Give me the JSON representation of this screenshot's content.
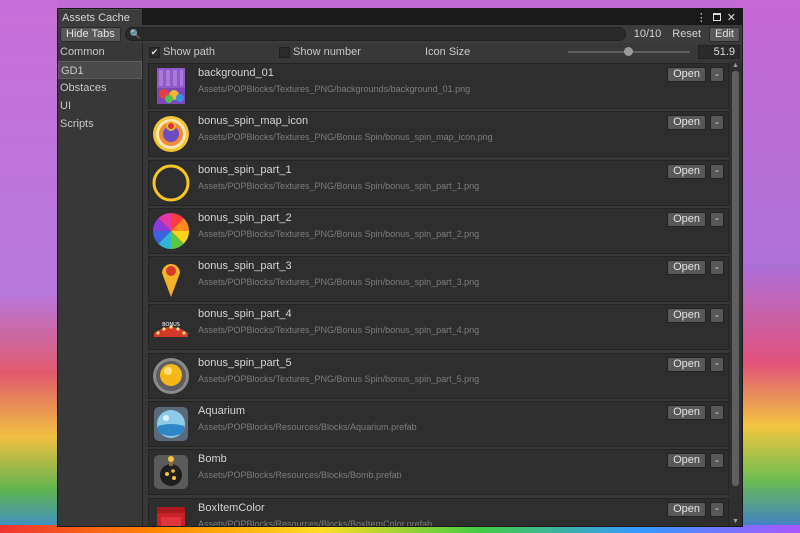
{
  "window": {
    "tab_title": "Assets Cache",
    "controls": {
      "menu": "⋮",
      "close": "✕"
    }
  },
  "toolbar": {
    "hide_tabs_label": "Hide Tabs",
    "search_icon": "🔍",
    "search_value": "",
    "count": "10/10",
    "reset_label": "Reset",
    "edit_label": "Edit"
  },
  "sidebar": {
    "items": [
      {
        "label": "Common",
        "active": false
      },
      {
        "label": "GD1",
        "active": true
      },
      {
        "label": "Obstaces",
        "active": false
      },
      {
        "label": "UI",
        "active": false
      },
      {
        "label": "Scripts",
        "active": false
      }
    ]
  },
  "options": {
    "show_path_label": "Show path",
    "show_path_checked": true,
    "show_number_label": "Show number",
    "show_number_checked": false,
    "icon_size_label": "Icon Size",
    "icon_size_value": "51.9",
    "icon_size_fraction": 0.49
  },
  "items": [
    {
      "name": "background_01",
      "path": "Assets/POPBlocks/Textures_PNG/backgrounds/background_01.png",
      "icon": "background-icon",
      "open_label": "Open",
      "remove_label": "-"
    },
    {
      "name": "bonus_spin_map_icon",
      "path": "Assets/POPBlocks/Textures_PNG/Bonus Spin/bonus_spin_map_icon.png",
      "icon": "spin-map-icon",
      "open_label": "Open",
      "remove_label": "-"
    },
    {
      "name": "bonus_spin_part_1",
      "path": "Assets/POPBlocks/Textures_PNG/Bonus Spin/bonus_spin_part_1.png",
      "icon": "ring-icon",
      "open_label": "Open",
      "remove_label": "-"
    },
    {
      "name": "bonus_spin_part_2",
      "path": "Assets/POPBlocks/Textures_PNG/Bonus Spin/bonus_spin_part_2.png",
      "icon": "color-wheel-icon",
      "open_label": "Open",
      "remove_label": "-"
    },
    {
      "name": "bonus_spin_part_3",
      "path": "Assets/POPBlocks/Textures_PNG/Bonus Spin/bonus_spin_part_3.png",
      "icon": "pointer-icon",
      "open_label": "Open",
      "remove_label": "-"
    },
    {
      "name": "bonus_spin_part_4",
      "path": "Assets/POPBlocks/Textures_PNG/Bonus Spin/bonus_spin_part_4.png",
      "icon": "lights-icon",
      "open_label": "Open",
      "remove_label": "-"
    },
    {
      "name": "bonus_spin_part_5",
      "path": "Assets/POPBlocks/Textures_PNG/Bonus Spin/bonus_spin_part_5.png",
      "icon": "button-icon",
      "open_label": "Open",
      "remove_label": "-"
    },
    {
      "name": "Aquarium",
      "path": "Assets/POPBlocks/Resources/Blocks/Aquarium.prefab",
      "icon": "aquarium-icon",
      "open_label": "Open",
      "remove_label": "-"
    },
    {
      "name": "Bomb",
      "path": "Assets/POPBlocks/Resources/Blocks/Bomb.prefab",
      "icon": "bomb-icon",
      "open_label": "Open",
      "remove_label": "-"
    },
    {
      "name": "BoxItemColor",
      "path": "Assets/POPBlocks/Resources/Blocks/BoxItemColor.prefab",
      "icon": "box-icon",
      "open_label": "Open",
      "remove_label": "-"
    }
  ],
  "scrollbar": {
    "up": "▲",
    "down": "▼"
  }
}
